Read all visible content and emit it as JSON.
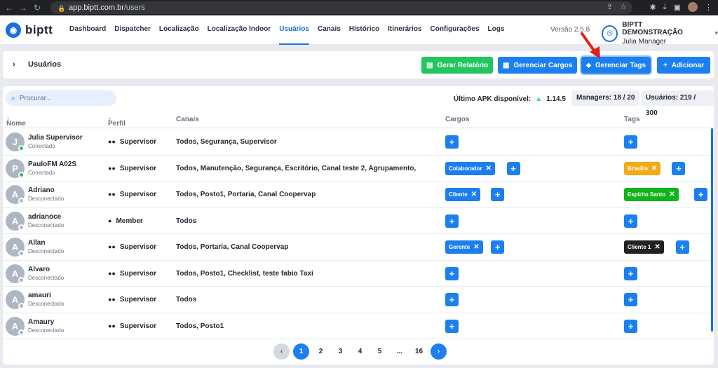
{
  "browser": {
    "url_host": "app.biptt.com.br",
    "url_path": "/users"
  },
  "header": {
    "logo_text": "biptt",
    "menu": [
      "Dashboard",
      "Dispatcher",
      "Localização",
      "Localização Indoor",
      "Usuários",
      "Canais",
      "Histórico",
      "Itinerários",
      "Configurações",
      "Logs"
    ],
    "active_menu": "Usuários",
    "version": "Versão 2.5.8",
    "org_name": "BIPTT DEMONSTRAÇÃO",
    "org_role": "Julia Manager"
  },
  "toolbar": {
    "title": "Usuários",
    "btn_report": "Gerar Relatório",
    "btn_roles": "Gerenciar Cargos",
    "btn_tags": "Gerenciar Tags",
    "btn_add": "Adicionar"
  },
  "table": {
    "search_placeholder": "Procurar...",
    "apk_label": "Último APK disponível:",
    "apk_version": "1.14.5",
    "managers": "Managers: 18 / 20",
    "users": "Usuários: 219 / 300",
    "columns": {
      "nome": "Nome",
      "perfil": "Perfil",
      "canais": "Canais",
      "cargos": "Cargos",
      "tags": "Tags"
    },
    "rows": [
      {
        "initial": "J",
        "name": "Julia Supervisor",
        "status": "Conectado",
        "online": true,
        "perfil": "Supervisor",
        "canais": "Todos, Segurança, Supervisor",
        "cargo": "",
        "tag": "",
        "tag_color": ""
      },
      {
        "initial": "P",
        "name": "PauloFM A02S",
        "status": "Conectado",
        "online": true,
        "perfil": "Supervisor",
        "canais": "Todos, Manutenção, Segurança, Escritório, Canal teste 2, Agrupamento,",
        "cargo": "Colaborador",
        "tag": "Brasília",
        "tag_color": "orange"
      },
      {
        "initial": "A",
        "name": "Adriano",
        "status": "Desconectado",
        "online": false,
        "perfil": "Supervisor",
        "canais": "Todos, Posto1, Portaria, Canal Coopervap",
        "cargo": "Cliente",
        "tag": "Espírito Santo",
        "tag_color": "green"
      },
      {
        "initial": "A",
        "name": "adrianoce",
        "status": "Desconectado",
        "online": false,
        "perfil": "Member",
        "canais": "Todos",
        "cargo": "",
        "tag": "",
        "tag_color": ""
      },
      {
        "initial": "A",
        "name": "Allan",
        "status": "Desconectado",
        "online": false,
        "perfil": "Supervisor",
        "canais": "Todos, Portaria, Canal Coopervap",
        "cargo": "Gerente",
        "tag": "Cliente 1",
        "tag_color": "dark"
      },
      {
        "initial": "A",
        "name": "Alvaro",
        "status": "Desconectado",
        "online": false,
        "perfil": "Supervisor",
        "canais": "Todos, Posto1, Checklist, teste fabio Taxi",
        "cargo": "",
        "tag": "",
        "tag_color": ""
      },
      {
        "initial": "A",
        "name": "amauri",
        "status": "Desconectado",
        "online": false,
        "perfil": "Supervisor",
        "canais": "Todos",
        "cargo": "",
        "tag": "",
        "tag_color": ""
      },
      {
        "initial": "A",
        "name": "Amaury",
        "status": "Desconectado",
        "online": false,
        "perfil": "Supervisor",
        "canais": "Todos, Posto1",
        "cargo": "",
        "tag": "",
        "tag_color": ""
      }
    ]
  },
  "pagination": {
    "pages": [
      "1",
      "2",
      "3",
      "4",
      "5",
      "...",
      "16"
    ],
    "current": "1"
  },
  "colors": {
    "accent": "#1b7ff0",
    "green": "#22c55e",
    "orange": "#f5a915",
    "tag_green": "#10b419",
    "dark": "#222222",
    "annotation_arrow": "#e02020"
  }
}
